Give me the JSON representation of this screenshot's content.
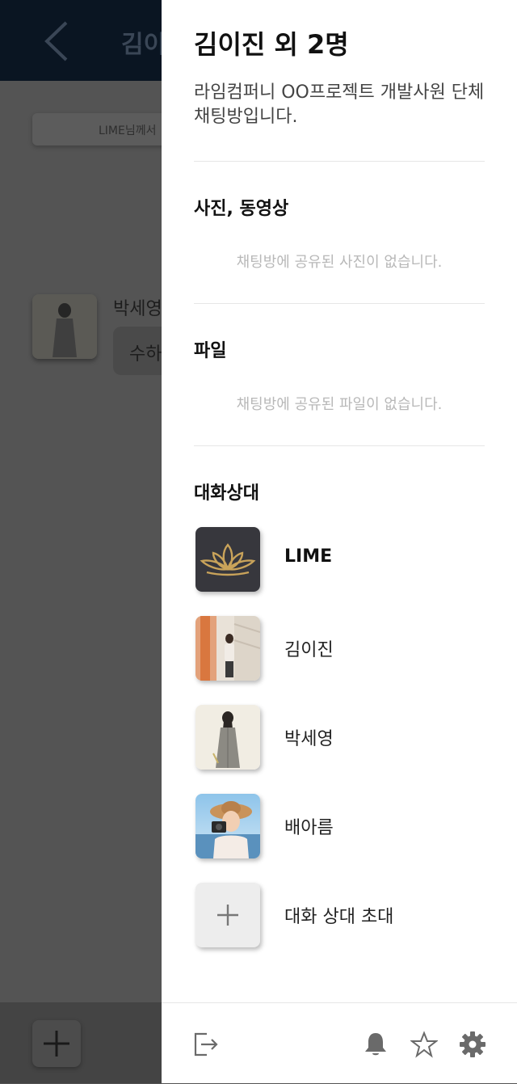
{
  "background": {
    "title": "김이",
    "notice": "LIME님께서",
    "sender": "박세영",
    "bubble": "수하"
  },
  "drawer": {
    "title": "김이진 외 2명",
    "description": "라임컴퍼니 OO프로젝트 개발사원 단체 채팅방입니다.",
    "photos": {
      "title": "사진, 동영상",
      "empty": "채팅방에 공유된 사진이 없습니다."
    },
    "files": {
      "title": "파일",
      "empty": "채팅방에 공유된 파일이 없습니다."
    },
    "members": {
      "title": "대화상대",
      "items": [
        {
          "name": "LIME"
        },
        {
          "name": "김이진"
        },
        {
          "name": "박세영"
        },
        {
          "name": "배아름"
        }
      ],
      "invite_label": "대화 상대 초대"
    },
    "footer": {
      "icons": [
        "exit-icon",
        "bell-icon",
        "star-icon",
        "gear-icon"
      ]
    }
  },
  "colors": {
    "overlay": "#545454",
    "lime_logo_bg": "#37373d",
    "lime_logo_gold": "#c9a35a",
    "icon_gray": "#6a6a6a"
  }
}
